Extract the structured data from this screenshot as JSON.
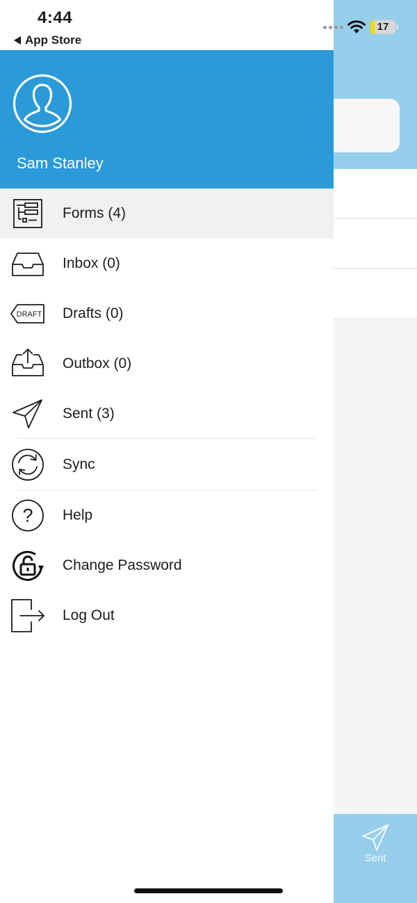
{
  "status_bar": {
    "time": "4:44",
    "back_app": "App Store",
    "battery_level": "17",
    "battery_fraction": 0.17
  },
  "drawer": {
    "user_name": "Sam Stanley",
    "items": [
      {
        "label": "Forms (4)",
        "icon": "forms-icon",
        "active": true
      },
      {
        "label": "Inbox (0)",
        "icon": "inbox-icon"
      },
      {
        "label": "Drafts (0)",
        "icon": "draft-tag-icon",
        "icon_text": "DRAFT"
      },
      {
        "label": "Outbox (0)",
        "icon": "outbox-icon"
      },
      {
        "label": "Sent (3)",
        "icon": "paper-plane-icon"
      },
      {
        "label": "Sync",
        "icon": "sync-icon"
      },
      {
        "label": "Help",
        "icon": "question-icon"
      },
      {
        "label": "Change Password",
        "icon": "lock-refresh-icon"
      },
      {
        "label": "Log Out",
        "icon": "logout-icon"
      }
    ]
  },
  "background_app": {
    "tab_label": "Sent"
  },
  "colors": {
    "header_blue": "#2b9ad9",
    "light_blue": "#96cfec",
    "active_row": "#f1f1f1",
    "battery_yellow": "#f5d90a"
  }
}
